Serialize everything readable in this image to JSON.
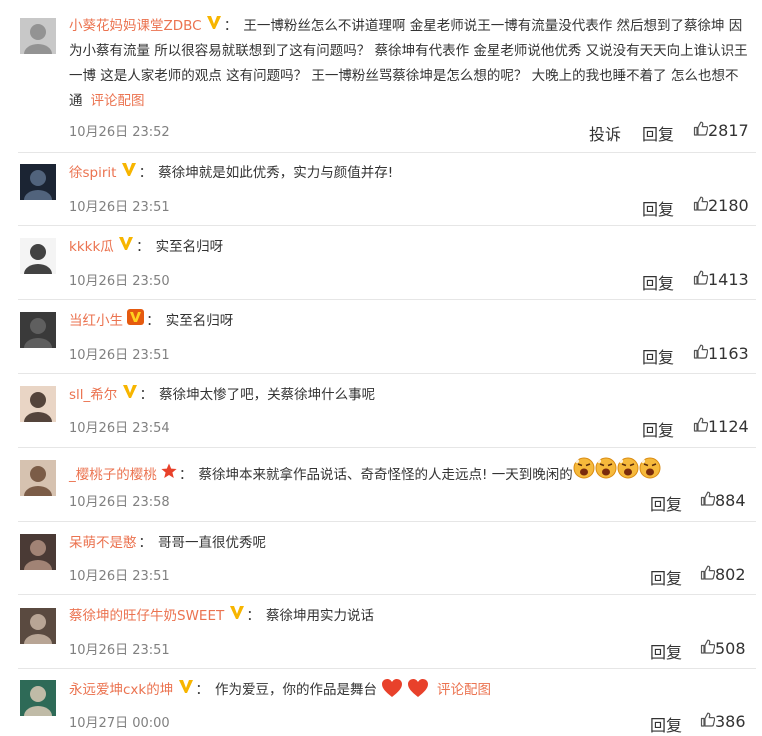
{
  "colors": {
    "username": "#eb7350",
    "meta": "#808080",
    "text": "#333333",
    "divider": "#e6e6e6",
    "vip_badge_gold": "#f7b500",
    "vip_badge_red": "#e55a0f"
  },
  "action_labels": {
    "report": "投诉",
    "reply": "回复",
    "view_pic": "评论配图"
  },
  "comments": [
    {
      "username": "小葵花妈妈课堂ZDBC",
      "badge": "vip-gold-icon",
      "text_lines": [
        "王一博粉丝怎么不讲道理啊 金星老师说王一博有流量没代表作 然后想到了蔡徐",
        "坤 因为小蔡有流量 所以很容易就联想到了这有问题吗？ 蔡徐坤有代表作 金星老师说他优秀 又说没有天天向",
        "上谁认识王一博 这是人家老师的观点 这有问题吗？ 王一博粉丝骂蔡徐坤是怎么想的呢？ 大晚上的我也睡不着",
        "了 怎么也想不通"
      ],
      "has_pic_link": true,
      "time": "10月26日 23:52",
      "likes": "2817",
      "has_report": true
    },
    {
      "username": "徐spirit",
      "badge": "vip-gold-icon",
      "text_lines": [
        "蔡徐坤就是如此优秀，实力与颜值并存!"
      ],
      "time": "10月26日 23:51",
      "likes": "2180"
    },
    {
      "username": "kkkk瓜",
      "badge": "vip-gold-icon",
      "text_lines": [
        "实至名归呀"
      ],
      "time": "10月26日 23:50",
      "likes": "1413"
    },
    {
      "username": "当红小生",
      "badge": "vip-red-icon",
      "text_lines": [
        "实至名归呀"
      ],
      "time": "10月26日 23:51",
      "likes": "1163"
    },
    {
      "username": "sll_希尔",
      "badge": "vip-gold-icon",
      "text_lines": [
        "蔡徐坤太惨了吧，关蔡徐坤什么事呢"
      ],
      "time": "10月26日 23:54",
      "likes": "1124"
    },
    {
      "username": "_樱桃子的樱桃",
      "badge": "star-icon",
      "text_lines": [
        "蔡徐坤本来就拿作品说话、奇奇怪怪的人走远点! 一天到晚闲的"
      ],
      "emoji_count": 4,
      "time": "10月26日 23:58",
      "likes": "884"
    },
    {
      "username": "呆萌不是憨",
      "badge": "",
      "text_lines": [
        "哥哥一直很优秀呢"
      ],
      "time": "10月26日 23:51",
      "likes": "802"
    },
    {
      "username": "蔡徐坤的旺仔牛奶SWEET",
      "badge": "vip-gold-icon",
      "text_lines": [
        "蔡徐坤用实力说话"
      ],
      "time": "10月26日 23:51",
      "likes": "508"
    },
    {
      "username": "永远爱坤cxk的坤",
      "badge": "vip-gold-icon",
      "text_lines": [
        "作为爱豆，你的作品是舞台"
      ],
      "hearts": 2,
      "has_pic_link": true,
      "time": "10月27日 00:00",
      "likes": "386"
    }
  ]
}
